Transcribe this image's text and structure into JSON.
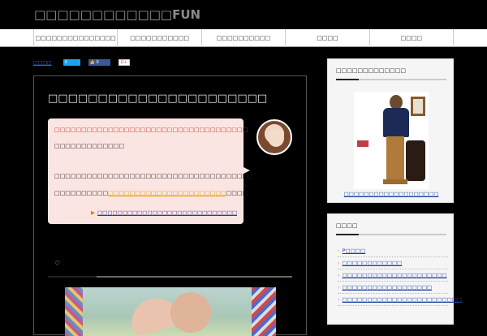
{
  "header": {
    "logo_text": "□□□□□□□□□□□□",
    "logo_suffix": "FUN"
  },
  "nav": {
    "items": [
      "□□□□□□□□□□□□□□□",
      "□□□□□□□□□□□",
      "□□□□□□□□□□",
      "□□□□",
      "□□□□"
    ]
  },
  "share": {
    "link_text": "□□□□",
    "twitter_count": "0",
    "facebook_count": "0",
    "gplus_label": "G+"
  },
  "article": {
    "title": "□□□□□□□□□□□□□□□□□□□□□□",
    "bubble": {
      "line1": "□□□□□□□□□□□□□□□□□□□□□□□□□□□□□□□□□□□□",
      "line2": "□□□□□□□□□□□□□",
      "line3": "□□□□□□□□□□□□□□□□□□□□□□□□□□□□□□□□□□□□□",
      "line4_pre": "□□□□□□□□□□",
      "line4_highlight": "□□□□□□□□□□□□□□□□□□□□□□",
      "line4_post": "□□□□",
      "link": "□□□□□□□□□□□□□□□□□□□□□□□□□□□□"
    },
    "heart_icon": "♡"
  },
  "sidebar": {
    "widget1": {
      "title": "□□□□□□□□□□□□□",
      "caption": "□□□□□□□□□□□□□□□□□□□"
    },
    "widget2": {
      "title": "□□□□",
      "items": [
        "P□□□□",
        "□□□□□□□□□□□□",
        "□□□□□□□□□□□□□□□□□□□□□",
        "□□□□□□□□□□□□□□□□□□",
        "□□□□□□□□□□□□□□□□□□□□□□□□"
      ]
    }
  }
}
